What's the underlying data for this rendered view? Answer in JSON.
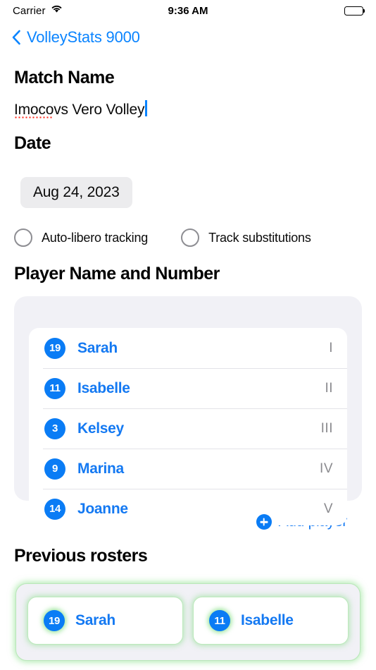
{
  "status_bar": {
    "carrier": "Carrier",
    "wifi_icon": "wifi-icon",
    "time": "9:36 AM",
    "battery_icon": "battery-full-icon"
  },
  "nav": {
    "back_icon": "chevron-left-icon",
    "title": "VolleyStats 9000"
  },
  "match_name": {
    "heading": "Match Name",
    "value_misspelled": "Imoco",
    "value_rest": " vs Vero Volley",
    "placeholder": "Match Name"
  },
  "date": {
    "heading": "Date",
    "value": "Aug 24, 2023"
  },
  "options": [
    {
      "label": "Auto-libero tracking",
      "checked": false
    },
    {
      "label": "Track substitutions",
      "checked": false
    }
  ],
  "players_section": {
    "heading": "Player Name and Number",
    "rows": [
      {
        "number": "19",
        "name": "Sarah",
        "position": "I"
      },
      {
        "number": "11",
        "name": "Isabelle",
        "position": "II"
      },
      {
        "number": "3",
        "name": "Kelsey",
        "position": "III"
      },
      {
        "number": "9",
        "name": "Marina",
        "position": "IV"
      },
      {
        "number": "14",
        "name": "Joanne",
        "position": "V"
      }
    ],
    "add_button": {
      "icon": "plus-circle-icon",
      "label": "Add player"
    }
  },
  "previous_rosters": {
    "heading": "Previous rosters",
    "chips": [
      {
        "number": "19",
        "name": "Sarah"
      },
      {
        "number": "11",
        "name": "Isabelle"
      }
    ]
  },
  "colors": {
    "accent_blue": "#0a7cf5",
    "link_blue": "#1479f2",
    "nav_blue": "#0a84ff",
    "card_gray": "#f1f1f6",
    "pill_gray": "#ececee",
    "muted_gray": "#8a8a8e",
    "roster_green": "#b9e6b9",
    "spell_red": "#ff2d20"
  }
}
